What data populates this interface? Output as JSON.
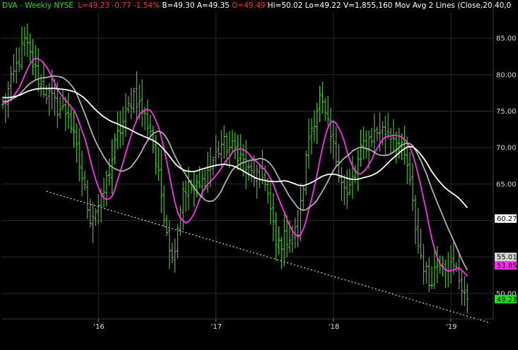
{
  "header": {
    "symbol": "DVA",
    "period": "Weekly",
    "exchange": "NYSE",
    "last": "L=49.23",
    "change": "-0.77",
    "change_pct": "-1.54%",
    "bid": "B=49.30",
    "ask": "A=49.35",
    "open": "O=49.49",
    "high": "Hi=50.02",
    "low": "Lo=49.22",
    "volume": "V=1,855,160",
    "study": "Mov Avg 2 Lines (Close,20,40,0"
  },
  "colors": {
    "price_bars": "#55dd2b",
    "ma20": "#b0b0b0",
    "ma40": "#ffffff",
    "ma10": "#ff2ef0",
    "trendline": "#ffffff",
    "text_green": "#22dd22",
    "text_red": "#ff3333",
    "text_white": "#ffffff"
  },
  "chart_data": {
    "type": "ohlc",
    "x_tick_labels": [
      "'16",
      "'17",
      "'18",
      "'19"
    ],
    "y_ticks": [
      50,
      55,
      60,
      65,
      70,
      75,
      80,
      85
    ],
    "y_tick_labels": [
      "50.00",
      "55.00",
      "60.00",
      "65.00",
      "70.00",
      "75.00",
      "80.00",
      "85.00"
    ],
    "ylim": [
      46.5,
      88.5
    ],
    "grid": true,
    "price_tags": [
      {
        "label": "60.27",
        "value": 60.27,
        "color": "#ffffff",
        "text_color": "#000000"
      },
      {
        "label": "55.01",
        "value": 55.01,
        "color": "#d8d8d8",
        "text_color": "#000000"
      },
      {
        "label": "53.85",
        "value": 53.85,
        "color": "#ff2ef0",
        "text_color": "#000000"
      },
      {
        "label": "49.23",
        "value": 49.23,
        "color": "#22dd22",
        "text_color": "#000000"
      }
    ],
    "close_keypoints": [
      [
        0,
        75.5
      ],
      [
        8,
        84.5
      ],
      [
        14,
        78.5
      ],
      [
        20,
        75.5
      ],
      [
        24,
        74.8
      ],
      [
        32,
        60.5
      ],
      [
        36,
        62.5
      ],
      [
        42,
        71.5
      ],
      [
        48,
        77.5
      ],
      [
        54,
        72.5
      ],
      [
        62,
        54.5
      ],
      [
        66,
        64.5
      ],
      [
        72,
        64.5
      ],
      [
        80,
        70.5
      ],
      [
        86,
        69.5
      ],
      [
        90,
        66.5
      ],
      [
        96,
        65.8
      ],
      [
        100,
        56.5
      ],
      [
        104,
        57.8
      ],
      [
        108,
        58.5
      ],
      [
        112,
        71.5
      ],
      [
        116,
        76.8
      ],
      [
        122,
        68.5
      ],
      [
        126,
        63.2
      ],
      [
        132,
        70.5
      ],
      [
        138,
        72.5
      ],
      [
        144,
        71.5
      ],
      [
        148,
        67.5
      ],
      [
        152,
        56.5
      ],
      [
        156,
        51.5
      ],
      [
        160,
        55.0
      ],
      [
        166,
        53.0
      ],
      [
        170,
        49.23
      ]
    ],
    "series": [
      {
        "name": "",
        "type": "moving_average",
        "period": 10,
        "color": "#ff2ef0"
      },
      {
        "name": "",
        "type": "moving_average",
        "period": 20,
        "color": "#b0b0b0"
      },
      {
        "name": "",
        "type": "moving_average",
        "period": 40,
        "color": "#ffffff"
      }
    ],
    "trendline": {
      "start": [
        16,
        64.0
      ],
      "end": [
        178,
        46.0
      ],
      "style": "dotted"
    }
  }
}
